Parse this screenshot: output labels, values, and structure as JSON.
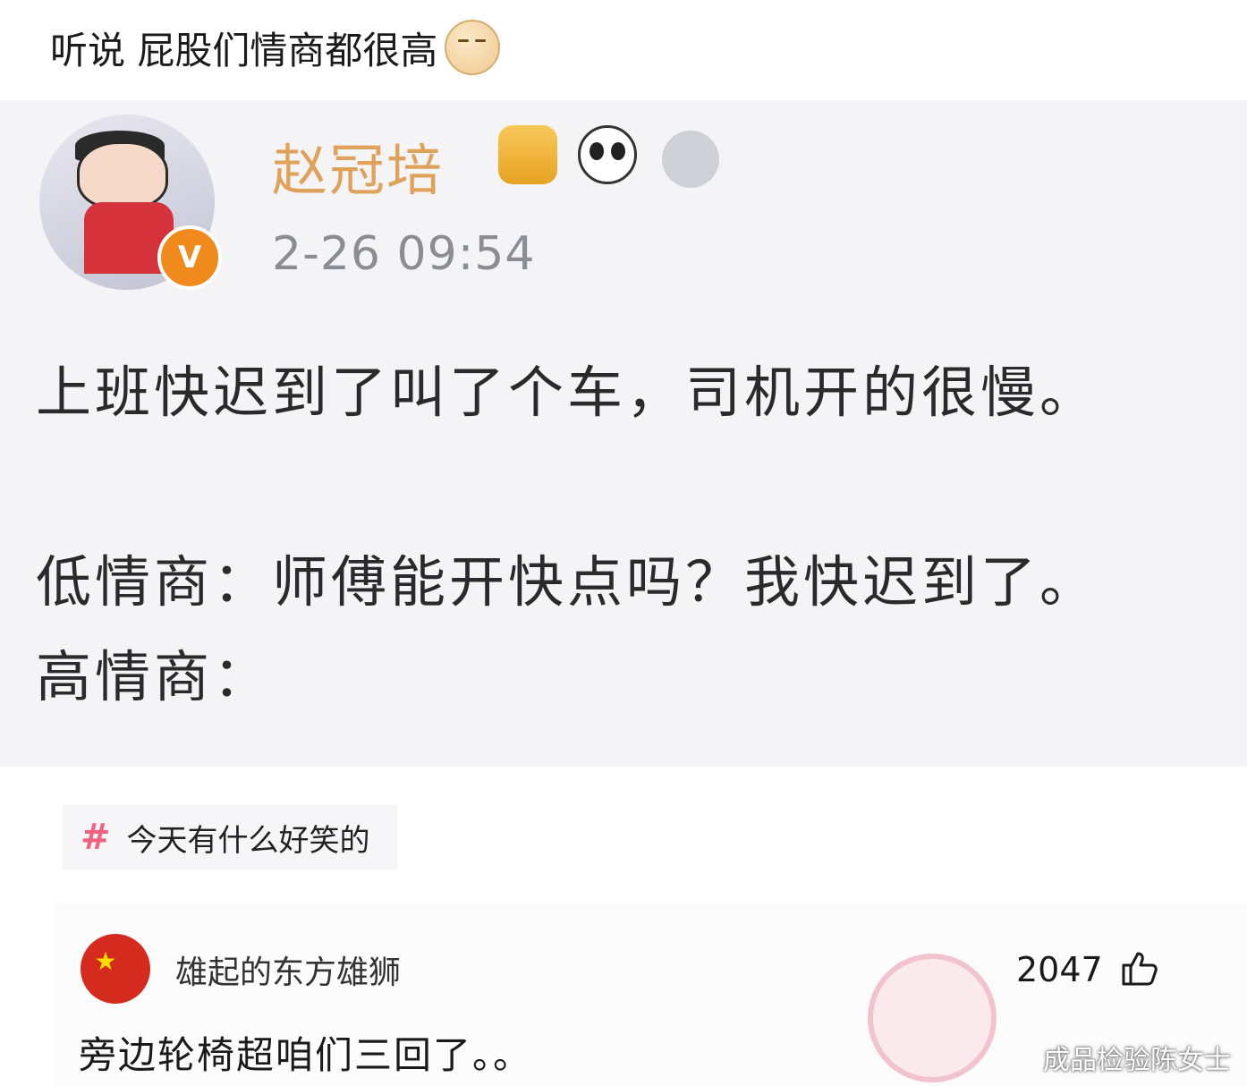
{
  "caption": {
    "text": "听说 屁股们情商都很高",
    "emoji": "smirk-face-emoji"
  },
  "post": {
    "username": "赵冠培",
    "badges": [
      "crown-badge",
      "panda-badge",
      "medal-badge"
    ],
    "verified_mark": "V",
    "timestamp": "2-26 09:54",
    "line1": "上班快迟到了叫了个车，司机开的很慢。",
    "line2": "低情商：师傅能开快点吗？我快迟到了。",
    "line3": "高情商："
  },
  "topic": {
    "hash": "#",
    "label": "今天有什么好笑的"
  },
  "comment": {
    "author": "雄起的东方雄狮",
    "likes": "2047",
    "text": "旁边轮椅超咱们三回了。。"
  },
  "watermark": "成品检验陈女士",
  "colors": {
    "username": "#e0a25a",
    "verified": "#f08a1c",
    "hash": "#f06482",
    "flag": "#d52b1e"
  }
}
